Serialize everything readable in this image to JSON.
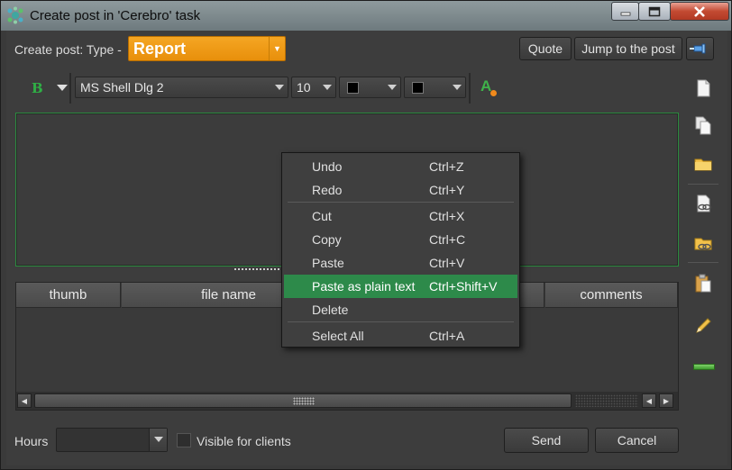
{
  "window": {
    "title": "Create post in 'Cerebro' task"
  },
  "header": {
    "type_label": "Create post: Type -",
    "type_value": "Report",
    "quote_label": "Quote",
    "jump_label": "Jump to the post"
  },
  "toolbar": {
    "bold_glyph": "B",
    "font_name": "MS Shell Dlg 2",
    "font_size": "10",
    "text_color": "#000000",
    "bg_color": "#000000",
    "format_glyph": "A"
  },
  "table": {
    "columns": [
      "thumb",
      "file name",
      "",
      "comments"
    ]
  },
  "context_menu": {
    "items": [
      {
        "label": "Undo",
        "shortcut": "Ctrl+Z"
      },
      {
        "label": "Redo",
        "shortcut": "Ctrl+Y"
      },
      {
        "label": "Cut",
        "shortcut": "Ctrl+X"
      },
      {
        "label": "Copy",
        "shortcut": "Ctrl+C"
      },
      {
        "label": "Paste",
        "shortcut": "Ctrl+V"
      },
      {
        "label": "Paste as plain text",
        "shortcut": "Ctrl+Shift+V"
      },
      {
        "label": "Delete",
        "shortcut": ""
      },
      {
        "label": "Select All",
        "shortcut": "Ctrl+A"
      }
    ],
    "highlighted_index": 5
  },
  "footer": {
    "hours_label": "Hours",
    "hours_value": "",
    "visible_label": "Visible for clients",
    "visible_checked": false,
    "send_label": "Send",
    "cancel_label": "Cancel"
  },
  "colors": {
    "accent_orange": "#f5a623",
    "highlight_green": "#2d8a4a",
    "editor_border": "#2b8a3e"
  }
}
